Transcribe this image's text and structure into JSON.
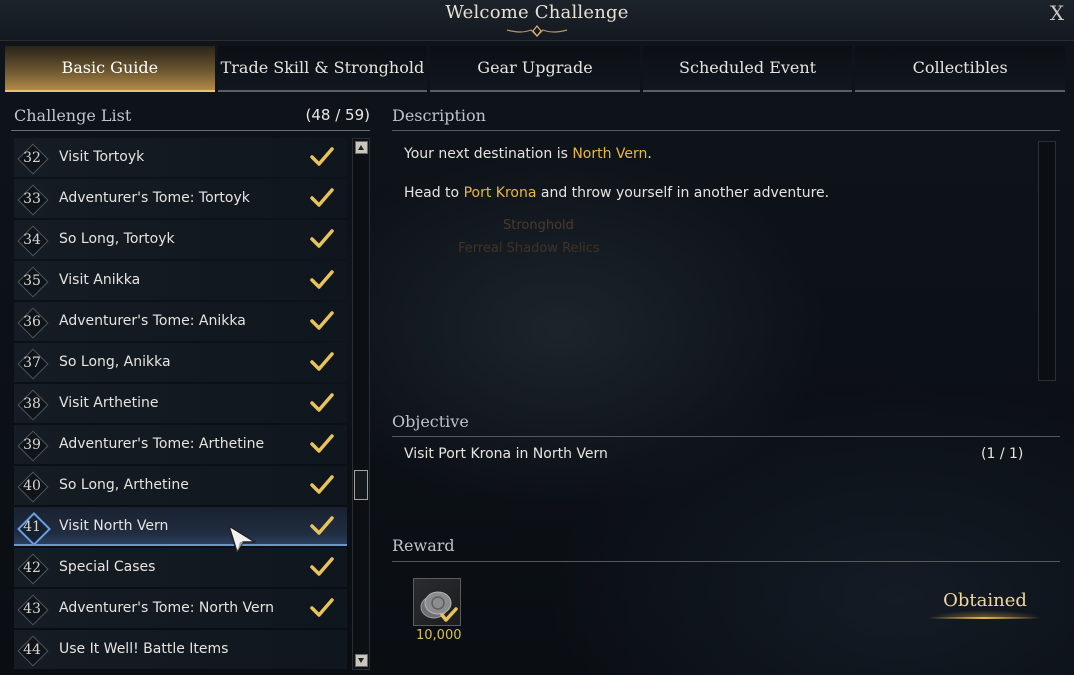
{
  "window": {
    "title": "Welcome Challenge",
    "close_label": "X"
  },
  "tabs": [
    {
      "label": "Basic Guide",
      "active": true
    },
    {
      "label": "Trade Skill & Stronghold"
    },
    {
      "label": "Gear Upgrade"
    },
    {
      "label": "Scheduled Event"
    },
    {
      "label": "Collectibles"
    }
  ],
  "challenge_list": {
    "label": "Challenge List",
    "count": "(48 / 59)",
    "items": [
      {
        "num": "32",
        "label": "Visit Tortoyk",
        "completed": true
      },
      {
        "num": "33",
        "label": "Adventurer's Tome: Tortoyk",
        "completed": true
      },
      {
        "num": "34",
        "label": "So Long, Tortoyk",
        "completed": true
      },
      {
        "num": "35",
        "label": "Visit Anikka",
        "completed": true
      },
      {
        "num": "36",
        "label": "Adventurer's Tome: Anikka",
        "completed": true
      },
      {
        "num": "37",
        "label": "So Long, Anikka",
        "completed": true
      },
      {
        "num": "38",
        "label": "Visit Arthetine",
        "completed": true
      },
      {
        "num": "39",
        "label": "Adventurer's Tome: Arthetine",
        "completed": true
      },
      {
        "num": "40",
        "label": "So Long, Arthetine",
        "completed": true
      },
      {
        "num": "41",
        "label": "Visit North Vern",
        "completed": true,
        "selected": true
      },
      {
        "num": "42",
        "label": "Special Cases",
        "completed": true
      },
      {
        "num": "43",
        "label": "Adventurer's Tome: North Vern",
        "completed": true
      },
      {
        "num": "44",
        "label": "Use It Well! Battle Items",
        "completed": false
      }
    ]
  },
  "description": {
    "label": "Description",
    "line1": {
      "prefix": "Your next destination is ",
      "highlight": "North Vern",
      "suffix": "."
    },
    "line2": {
      "prefix": "Head to ",
      "highlight": "Port Krona",
      "suffix": " and throw yourself in another adventure."
    },
    "bg_text_1": "Stronghold",
    "bg_text_2": "Ferreal Shadow Relics"
  },
  "objective": {
    "label": "Objective",
    "text": "Visit Port Krona in North Vern",
    "progress": "(1 / 1)"
  },
  "reward": {
    "label": "Reward",
    "icon": "silver-coins-icon",
    "amount": "10,000",
    "status": "Obtained"
  },
  "colors": {
    "highlight": "#e8b83e",
    "check": "#e8c25a",
    "selected_accent": "#6a96cc",
    "tab_active": "#b38a45"
  }
}
